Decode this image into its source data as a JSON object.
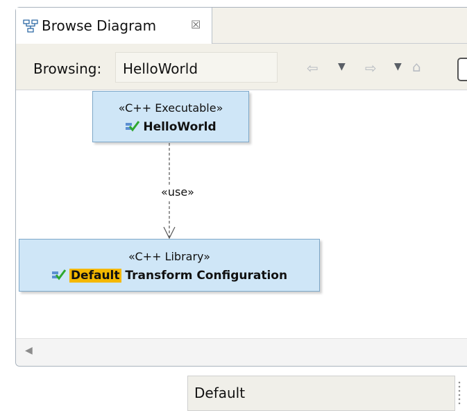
{
  "tab": {
    "title": "Browse Diagram",
    "icon": "diagram-icon",
    "close_glyph": "☒"
  },
  "toolbar": {
    "browsing_label": "Browsing:",
    "browsing_value": "HelloWorld",
    "back_glyph": "⇦",
    "forward_glyph": "⇨",
    "dropdown_glyph": "▼",
    "home_glyph": "⌂"
  },
  "diagram": {
    "executable": {
      "stereotype": "«C++ Executable»",
      "name": "HelloWorld",
      "icon": "check-config-icon"
    },
    "dependency_label": "«use»",
    "library": {
      "stereotype": "«C++ Library»",
      "name_highlight": "Default",
      "name_rest": " Transform Configuration",
      "icon": "check-config-icon"
    },
    "colors": {
      "node_fill": "#cfe6f7",
      "node_border": "#7da7c8",
      "highlight": "#f5b800",
      "check_green": "#2ea82e"
    }
  },
  "scrollbar": {
    "left_arrow_glyph": "◀"
  },
  "configuration": {
    "value": "Default"
  }
}
